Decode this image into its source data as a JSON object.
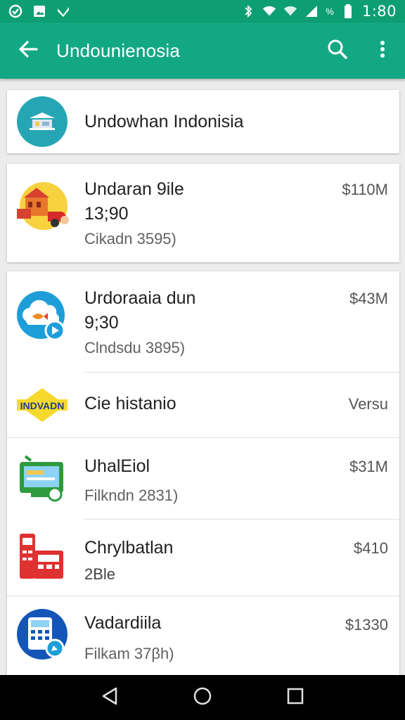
{
  "status_bar": {
    "time": "1:80",
    "battery_label": "%",
    "icons": [
      "app-notification-icon",
      "image-notification-icon",
      "check-notification-icon",
      "bluetooth-icon",
      "wifi-icon",
      "wifi-icon-2",
      "signal-icon",
      "battery-icon"
    ]
  },
  "app_bar": {
    "title": "Undounienosia",
    "back_icon": "arrow-back-icon",
    "search_icon": "search-icon",
    "menu_icon": "more-vert-icon"
  },
  "header_card": {
    "title": "Undowhan Indonisia",
    "icon": "building-icon"
  },
  "items": [
    {
      "title": "Undaran 9ile",
      "subtitle": "13;90",
      "detail": "Cikadn 3595)",
      "price": "$110M",
      "icon": "house-truck-icon"
    },
    {
      "title": "Urdoraaia dun",
      "subtitle": "9;30",
      "detail": "Clndsdu 3895)",
      "price": "$43M",
      "icon": "cloud-fish-icon"
    },
    {
      "title": "Cie histanio",
      "subtitle": "",
      "detail": "",
      "price": "Versu",
      "icon": "indovan-logo-icon",
      "logo_text": "INDVADN"
    },
    {
      "title": "UhalEiol",
      "subtitle": "",
      "detail": "Filkndn 2831)",
      "price": "$31M",
      "icon": "monitor-icon"
    },
    {
      "title": "Chrylbatlan",
      "subtitle": "2Ble",
      "detail": "",
      "price": "$410",
      "icon": "machine-icon"
    },
    {
      "title": "Vadardiila",
      "subtitle": "",
      "detail": "Filkam 37βh)",
      "price": "$1330",
      "icon": "calculator-icon"
    }
  ],
  "nav_bar": {
    "back_icon": "nav-back-icon",
    "home_icon": "nav-home-icon",
    "recents_icon": "nav-recents-icon"
  },
  "colors": {
    "status_bar": "#0e9e73",
    "app_bar": "#13a884",
    "header_icon_bg": "#26a6b4"
  }
}
